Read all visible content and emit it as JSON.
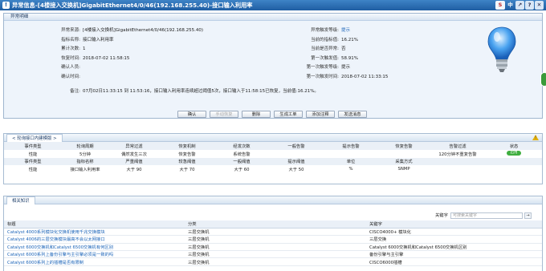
{
  "window": {
    "title": "异常信息-[4楼接入交换机]GigabitEthernet4/0/46(192.168.255.40)-接口输入利用率",
    "logo": "S",
    "lang": "中",
    "btns": [
      "↗",
      "?",
      "✕"
    ]
  },
  "detail": {
    "section_title": "异常明细",
    "left": [
      {
        "label": "异常来源:",
        "value": "[4楼接入交换机]GigabitEthernet4/0/46(192.168.255.40)"
      },
      {
        "label": "指标名称:",
        "value": "接口输入利用率"
      },
      {
        "label": "累计次数:",
        "value": "1"
      },
      {
        "label": "恢复时间:",
        "value": "2018-07-02 11:58:15"
      },
      {
        "label": "确认人员:",
        "value": ""
      },
      {
        "label": "确认时间:",
        "value": ""
      }
    ],
    "right": [
      {
        "label": "异常触发等级:",
        "value": "提示"
      },
      {
        "label": "当前的指标值:",
        "value": "16.21%"
      },
      {
        "label": "当前是否异常:",
        "value": "否"
      },
      {
        "label": "第一次触发值:",
        "value": "58.91%"
      },
      {
        "label": "第一次触发等级:",
        "value": "提示"
      },
      {
        "label": "第一次触发时间:",
        "value": "2018-07-02 11:33:15"
      }
    ],
    "summary_label": "备注:",
    "summary": "07月02日11:33:15 到 11:53:16，接口输入利用率连续超过阈值5次，接口输入于11:58:15已恢复，当前值:16.21%。"
  },
  "actions": [
    "确认",
    "手动恢复",
    "删除",
    "生成工单",
    "添加注释",
    "发送消息"
  ],
  "rules": {
    "tab": "< 轮询接口内建模版 >",
    "head1": [
      "事件类型",
      "轮询周期",
      "异常过滤",
      "恢复机制",
      "经发次数",
      "一般告警",
      "提示告警",
      "恢复告警",
      "告警过滤",
      "状态"
    ],
    "row1": [
      "性能",
      "5分钟",
      "偶然发生三次",
      "恢复告警",
      "系统告警",
      "",
      "",
      "",
      "120分钟不重复告警",
      "启用"
    ],
    "head2": [
      "事件类型",
      "指标名称",
      "严重阈值",
      "较急阈值",
      "一般阈值",
      "提示阈值",
      "单位",
      "采集方式"
    ],
    "row2": [
      "性能",
      "接口输入利用率",
      "大于 90",
      "大于 70",
      "大于 60",
      "大于 50",
      "%",
      "SNMP"
    ]
  },
  "kb": {
    "tab": "相关知识",
    "search_label": "关键字",
    "search_placeholder": "可搜索关键字",
    "search_btn": "→",
    "head": [
      "标题",
      "分类",
      "关键字"
    ],
    "rows": [
      [
        "Catalyst 4000系列模块化交换机使用千兆交换模块",
        "三层交换机",
        "CISCO4000+ 模块化"
      ],
      [
        "Catalyst 4006的三层交换模块最高不会以太网接口",
        "三层交换机",
        "三层交换"
      ],
      [
        "Catalyst 6000交换机和Catalyst 6500交换机有何区别",
        "三层交换机",
        "Catalyst 6000交换机和Catalyst 6500交换机区别"
      ],
      [
        "Catalyst 6000系列上备份引擎与主引擎必须是一致的吗",
        "三层交换机",
        "备份引擎与主引擎"
      ],
      [
        "Catalyst 6000系列上的插槽是否有限制",
        "三层交换机",
        "CISCO6000插槽"
      ]
    ]
  },
  "colors": {
    "title_bar": "#2a6db5",
    "link": "#1a63b8",
    "toggle_on": "#3fae3f"
  }
}
